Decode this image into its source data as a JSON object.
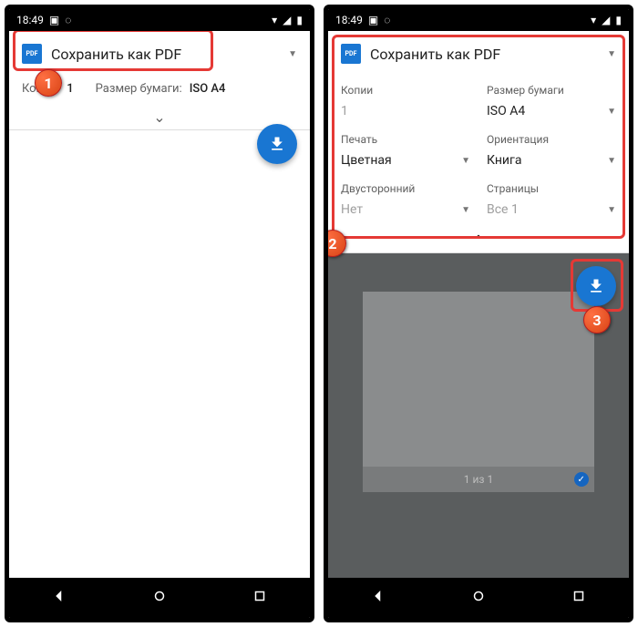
{
  "statusbar": {
    "time": "18:49"
  },
  "destination": {
    "label": "Сохранить как PDF"
  },
  "summary": {
    "copies_label": "Копии:",
    "copies_value": "1",
    "paper_label": "Размер бумаги:",
    "paper_value": "ISO A4"
  },
  "settings": {
    "copies": {
      "label": "Копии",
      "value": "1"
    },
    "paper": {
      "label": "Размер бумаги",
      "value": "ISO A4"
    },
    "print": {
      "label": "Печать",
      "value": "Цветная"
    },
    "orientation": {
      "label": "Ориентация",
      "value": "Книга"
    },
    "duplex": {
      "label": "Двусторонний",
      "value": "Нет"
    },
    "pages": {
      "label": "Страницы",
      "value": "Все 1"
    }
  },
  "preview": {
    "page_counter": "1 из 1"
  },
  "markers": {
    "one": "1",
    "two": "2",
    "three": "3"
  }
}
